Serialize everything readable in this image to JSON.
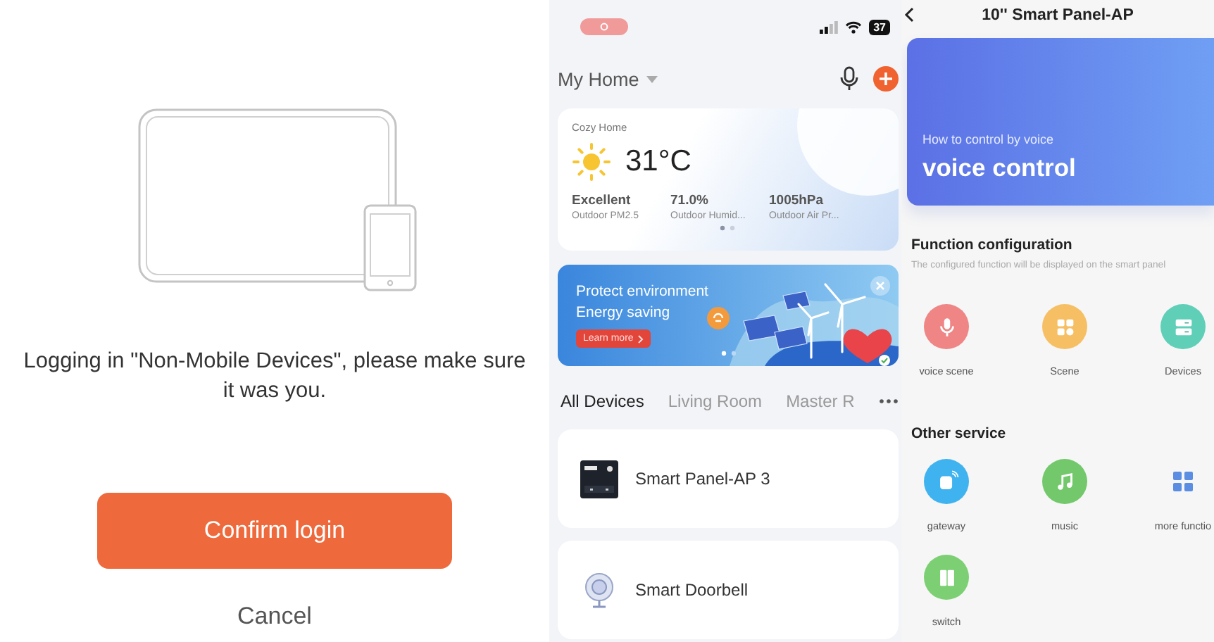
{
  "login_screen": {
    "message": "Logging in \"Non-Mobile Devices\", please make sure it was you.",
    "confirm_button": "Confirm login",
    "cancel_button": "Cancel"
  },
  "home_screen": {
    "status_bar": {
      "battery": "37"
    },
    "home_selector": "My Home",
    "weather_card": {
      "location": "Cozy Home",
      "temperature": "31°C",
      "stats": [
        {
          "value": "Excellent",
          "label": "Outdoor PM2.5"
        },
        {
          "value": "71.0%",
          "label": "Outdoor Humid..."
        },
        {
          "value": "1005hPa",
          "label": "Outdoor Air Pr..."
        }
      ]
    },
    "banner": {
      "line_1": "Protect environment",
      "line_2": "Energy saving",
      "button": "Learn more"
    },
    "room_tabs": [
      {
        "label": "All Devices",
        "selected": true
      },
      {
        "label": "Living Room",
        "selected": false
      },
      {
        "label": "Master R",
        "selected": false
      }
    ],
    "devices": [
      {
        "name": "Smart Panel-AP 3",
        "kind": "panel"
      },
      {
        "name": "Smart Doorbell",
        "kind": "doorbell"
      }
    ]
  },
  "panel_screen": {
    "title": "10'' Smart Panel-AP",
    "voice_card": {
      "subtitle": "How to control by voice",
      "title": "voice control"
    },
    "function_configuration": {
      "heading": "Function configuration",
      "description": "The configured function will be displayed on the smart panel",
      "items": [
        {
          "label": "voice scene",
          "kind": "voice",
          "color": "#ef8585"
        },
        {
          "label": "Scene",
          "kind": "scene",
          "color": "#f6bf63"
        },
        {
          "label": "Devices",
          "kind": "devices",
          "color": "#5fcfb8"
        }
      ]
    },
    "other_service": {
      "heading": "Other service",
      "items": [
        {
          "label": "gateway",
          "kind": "gateway",
          "color": "#3fb3ef"
        },
        {
          "label": "music",
          "kind": "music",
          "color": "#72c86a"
        },
        {
          "label": "more functio",
          "kind": "more",
          "color": "#5b8de3"
        },
        {
          "label": "switch",
          "kind": "switch",
          "color": "#7ccf73"
        }
      ]
    }
  }
}
